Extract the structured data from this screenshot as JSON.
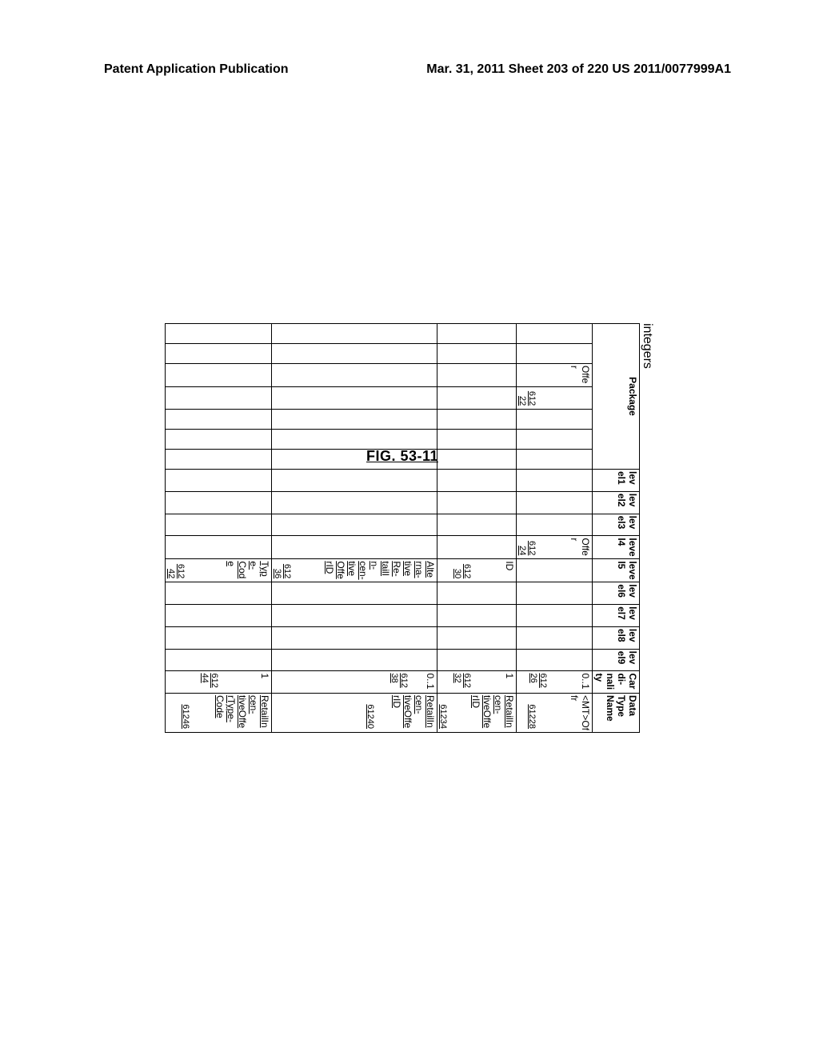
{
  "header": {
    "left": "Patent Application Publication",
    "right": "Mar. 31, 2011  Sheet 203 of 220   US 2011/0077999A1"
  },
  "figure_label": "FIG. 53-11",
  "columns": {
    "package": "Package",
    "level1": "level1",
    "level2": "level2",
    "level3": "level3",
    "level4": "level4",
    "level5": "level5",
    "level6": "level6",
    "level7": "level7",
    "level8": "level8",
    "level9": "level9",
    "cardinality": "Cardi-nality",
    "datatype": "Data Type Name"
  },
  "rows": [
    {
      "package_text": "Offer",
      "package_ref": "61222",
      "level4": "Offer",
      "level4_ref": "61224",
      "level5": "",
      "level5_ref": "",
      "cardinality": "0..1",
      "cardinality_ref": "61226",
      "datatype": "<MT>Offr",
      "datatype_ref": "61228"
    },
    {
      "package_text": "",
      "package_ref": "",
      "level4": "",
      "level4_ref": "",
      "level5": "ID",
      "level5_ref": "61230",
      "cardinality": "1",
      "cardinality_ref": "61232",
      "datatype": "RetailIncen-tiveOfferID",
      "datatype_ref": "61234"
    },
    {
      "package_text": "",
      "package_ref": "",
      "level4": "",
      "level4_ref": "",
      "level5": "Alterna-tiveRe-tailIn-cen-tiveOffe rID",
      "level5_ref": "61236",
      "cardinality": "0..1",
      "cardinality_ref": "61238",
      "datatype": "RetailIncen-tiveOfferID",
      "datatype_ref": "61240"
    },
    {
      "package_text": "",
      "package_ref": "",
      "level4": "",
      "level4_ref": "",
      "level5": "Type-Code",
      "level5_ref": "61242",
      "cardinality": "1",
      "cardinality_ref": "61244",
      "datatype": "RetailIncen-tiveOfferType-Code",
      "datatype_ref": "61246"
    }
  ]
}
